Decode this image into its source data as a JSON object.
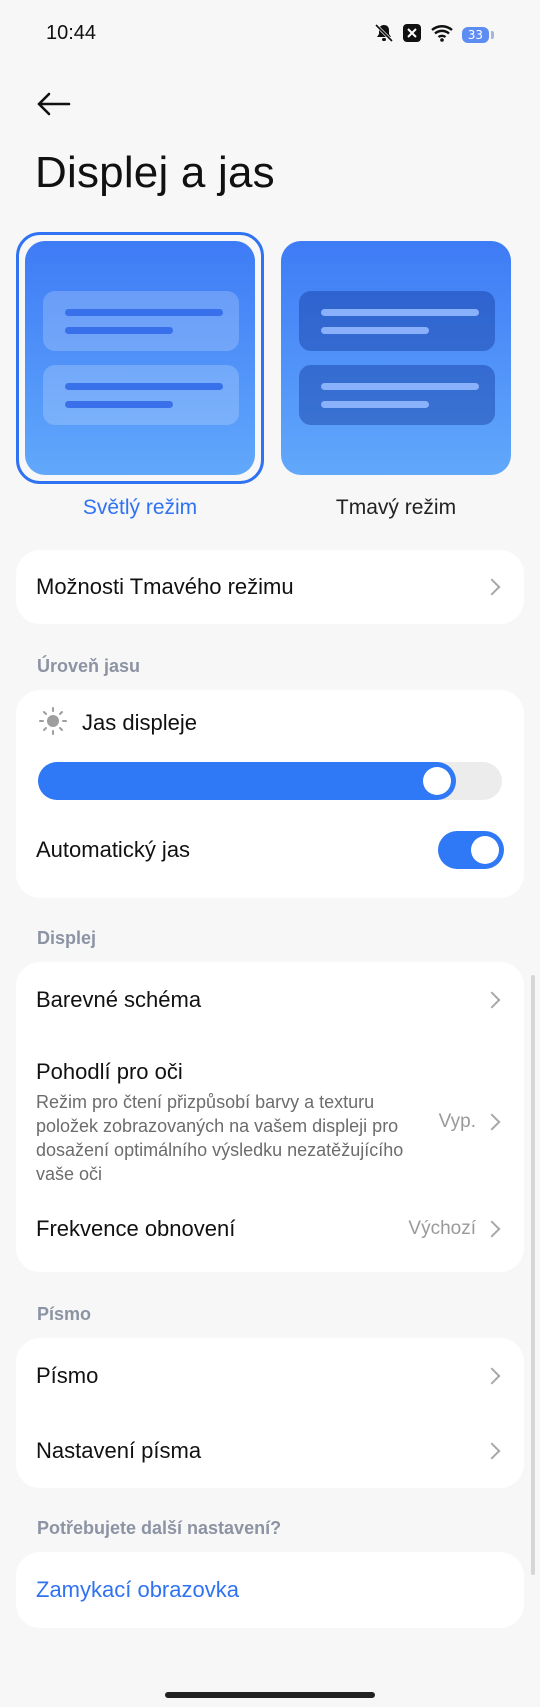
{
  "status_bar": {
    "time": "10:44",
    "battery": "33",
    "icons": [
      "bell-off-icon",
      "close-box-icon",
      "wifi-icon",
      "battery-icon"
    ]
  },
  "header": {
    "title": "Displej a jas",
    "back_icon": "arrow-left-icon"
  },
  "theme_modes": {
    "light_label": "Světlý režim",
    "dark_label": "Tmavý režim",
    "selected": "light",
    "accent": "#2f72f2"
  },
  "dark_mode_options": {
    "label": "Možnosti Tmavého režimu"
  },
  "brightness": {
    "section_label": "Úroveň jasu",
    "display_brightness_label": "Jas displeje",
    "display_brightness_icon": "sun-icon",
    "level": 0.9,
    "auto_brightness_label": "Automatický jas",
    "auto_brightness_on": true
  },
  "display": {
    "section_label": "Displej",
    "color_scheme_label": "Barevné schéma",
    "eye_comfort_label": "Pohodlí pro oči",
    "eye_comfort_desc": "Režim pro čtení přizpůsobí barvy a texturu položek zobrazovaných na vašem displeji pro dosažení optimálního výsledku nezatěžujícího vaše oči",
    "eye_comfort_value": "Vyp.",
    "refresh_rate_label": "Frekvence obnovení",
    "refresh_rate_value": "Výchozí"
  },
  "font": {
    "section_label": "Písmo",
    "font_label": "Písmo",
    "font_settings_label": "Nastavení písma"
  },
  "more": {
    "section_label": "Potřebujete další nastavení?",
    "lock_screen_label": "Zamykací obrazovka"
  }
}
